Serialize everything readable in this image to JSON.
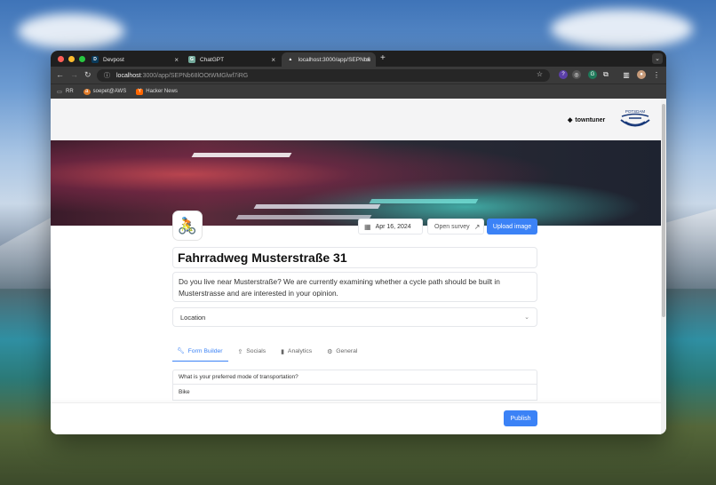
{
  "browser": {
    "tabs": [
      {
        "label": "Devpost",
        "favicon": "D"
      },
      {
        "label": "ChatGPT",
        "favicon": "G"
      },
      {
        "label": "localhost:3000/app/SEPNb6",
        "favicon": "▲"
      }
    ],
    "url_host": "localhost",
    "url_path": ":3000/app/SEPNb68lOOtWMGlwf7iRG",
    "bookmarks": [
      {
        "label": "RR",
        "icon": "folder-icon"
      },
      {
        "label": "soepet@AWS",
        "icon": "aws-icon"
      },
      {
        "label": "Hacker News",
        "icon": "hacker-news-icon"
      }
    ]
  },
  "brand": {
    "towntuner": "towntuner",
    "potsdam": "POTSDAM"
  },
  "survey": {
    "date": "Apr 16, 2024",
    "open_survey": "Open survey",
    "upload_image": "Upload image",
    "title": "Fahrradweg Musterstraße 31",
    "description": "Do you live near Musterstraße? We are currently examining whether a cycle path should be built in Musterstrasse and are interested in your opinion.",
    "location_placeholder": "Location",
    "avatar_emoji": "🚴"
  },
  "tabs": [
    {
      "label": "Form Builder",
      "icon": "wrench-icon",
      "active": true
    },
    {
      "label": "Socials",
      "icon": "share-icon",
      "active": false
    },
    {
      "label": "Analytics",
      "icon": "bar-chart-icon",
      "active": false
    },
    {
      "label": "General",
      "icon": "gear-icon",
      "active": false
    }
  ],
  "form": {
    "question": "What is your preferred mode of transportation?",
    "answer": "Bike"
  },
  "actions": {
    "publish": "Publish"
  },
  "colors": {
    "accent": "#3b82f6"
  }
}
